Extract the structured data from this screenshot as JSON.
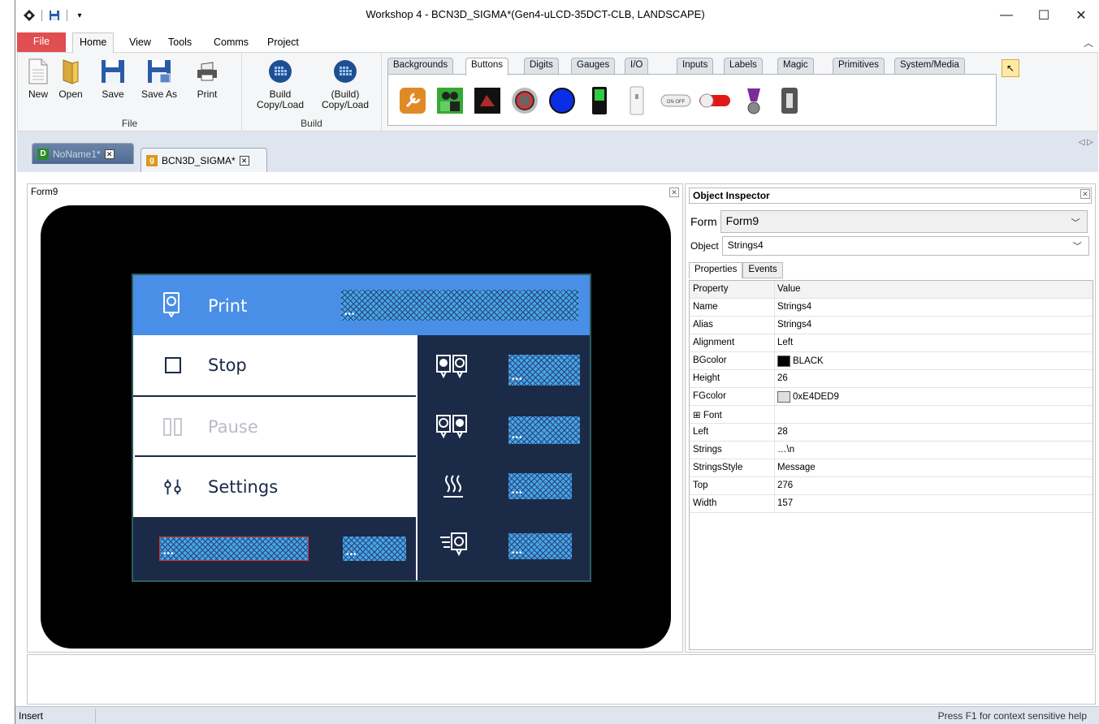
{
  "window": {
    "title": "Workshop 4 - BCN3D_SIGMA*(Gen4-uLCD-35DCT-CLB, LANDSCAPE)",
    "minimize": "—",
    "maximize": "☐",
    "close": "✕"
  },
  "ribbon": {
    "tabs": [
      "File",
      "Home",
      "View",
      "Tools",
      "Comms",
      "Project"
    ],
    "active_tab": "Home",
    "file_group": {
      "label": "File",
      "buttons": [
        "New",
        "Open",
        "Save",
        "Save As",
        "Print"
      ]
    },
    "build_group": {
      "label": "Build",
      "buttons": [
        "Build\nCopy/Load",
        "(Build)\nCopy/Load"
      ]
    },
    "palette_tabs": [
      "Backgrounds",
      "Buttons",
      "Digits",
      "Gauges",
      "I/O",
      "Inputs",
      "Labels",
      "Magic",
      "Primitives",
      "System/Media"
    ],
    "active_palette_tab": "Buttons",
    "palette_items": [
      "wrench-tool-icon",
      "users-button-icon",
      "4d-logo-button-icon",
      "round-metal-button-icon",
      "blue-circle-button-icon",
      "green-rocker-switch-icon",
      "slider-switch-icon",
      "on-off-toggle-icon",
      "red-toggle-icon",
      "purple-knob-switch-icon",
      "toggle-lever-switch-icon"
    ],
    "on_off_text": "ON OFF"
  },
  "doc_tabs": [
    {
      "label": "NoName1*",
      "icon": "D",
      "icon_color": "#2e8b2e"
    },
    {
      "label": "BCN3D_SIGMA*",
      "icon": "g",
      "icon_color": "#d89a1a"
    }
  ],
  "form": {
    "title": "Form9",
    "menu": [
      {
        "label": "Print",
        "icon": "printer-icon"
      },
      {
        "label": "Stop",
        "icon": "stop-square-icon"
      },
      {
        "label": "Pause",
        "icon": "pause-icon"
      },
      {
        "label": "Settings",
        "icon": "sliders-icon"
      }
    ],
    "side_icons": [
      "left-extruder-icon",
      "right-extruder-icon",
      "bed-heat-icon",
      "fan-printer-icon"
    ],
    "field_dots": "•••",
    "colors": {
      "accent": "#4a8fe7",
      "screen_bg": "#1b2a47",
      "hatch": "#44a6e6",
      "pause_text": "#b8bcc4"
    }
  },
  "inspector": {
    "title": "Object Inspector",
    "form_label": "Form",
    "form_value": "Form9",
    "object_label": "Object",
    "object_value": "Strings4",
    "tabs": [
      "Properties",
      "Events"
    ],
    "headers": {
      "property": "Property",
      "value": "Value"
    },
    "rows": [
      {
        "p": "Name",
        "v": "Strings4"
      },
      {
        "p": "Alias",
        "v": "Strings4"
      },
      {
        "p": "Alignment",
        "v": "Left"
      },
      {
        "p": "BGcolor",
        "v": "BLACK",
        "swatch": "#000000"
      },
      {
        "p": "Height",
        "v": "26"
      },
      {
        "p": "FGcolor",
        "v": "0xE4DED9",
        "swatch": "#e4ded9"
      },
      {
        "p": "⊞ Font",
        "v": ""
      },
      {
        "p": "Left",
        "v": "28"
      },
      {
        "p": "Strings",
        "v": "…\\n"
      },
      {
        "p": "StringsStyle",
        "v": "Message"
      },
      {
        "p": "Top",
        "v": "276"
      },
      {
        "p": "Width",
        "v": "157"
      }
    ]
  },
  "status": {
    "mode": "Insert",
    "help": "Press F1 for context sensitive help"
  }
}
